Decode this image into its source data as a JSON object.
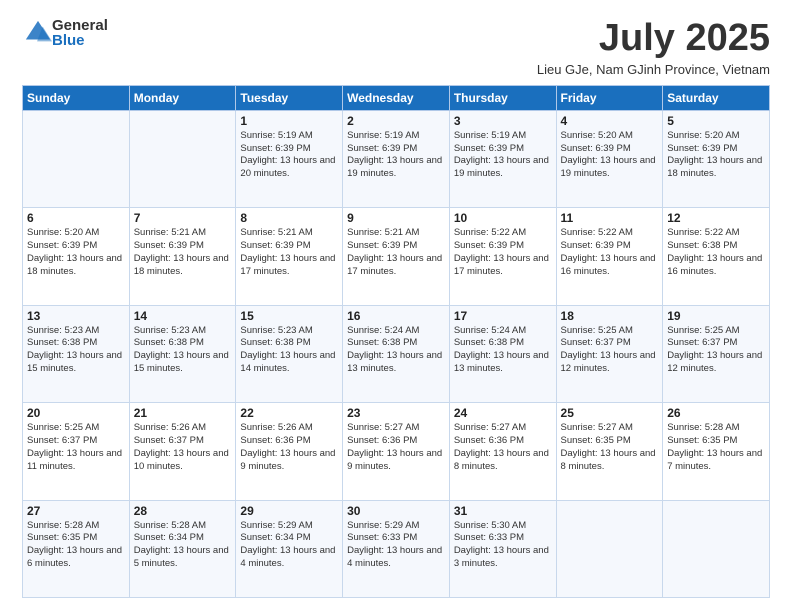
{
  "logo": {
    "general": "General",
    "blue": "Blue"
  },
  "header": {
    "month": "July 2025",
    "location": "Lieu GJe, Nam GJinh Province, Vietnam"
  },
  "days_of_week": [
    "Sunday",
    "Monday",
    "Tuesday",
    "Wednesday",
    "Thursday",
    "Friday",
    "Saturday"
  ],
  "weeks": [
    [
      {
        "day": "",
        "info": ""
      },
      {
        "day": "",
        "info": ""
      },
      {
        "day": "1",
        "info": "Sunrise: 5:19 AM\nSunset: 6:39 PM\nDaylight: 13 hours and 20 minutes."
      },
      {
        "day": "2",
        "info": "Sunrise: 5:19 AM\nSunset: 6:39 PM\nDaylight: 13 hours and 19 minutes."
      },
      {
        "day": "3",
        "info": "Sunrise: 5:19 AM\nSunset: 6:39 PM\nDaylight: 13 hours and 19 minutes."
      },
      {
        "day": "4",
        "info": "Sunrise: 5:20 AM\nSunset: 6:39 PM\nDaylight: 13 hours and 19 minutes."
      },
      {
        "day": "5",
        "info": "Sunrise: 5:20 AM\nSunset: 6:39 PM\nDaylight: 13 hours and 18 minutes."
      }
    ],
    [
      {
        "day": "6",
        "info": "Sunrise: 5:20 AM\nSunset: 6:39 PM\nDaylight: 13 hours and 18 minutes."
      },
      {
        "day": "7",
        "info": "Sunrise: 5:21 AM\nSunset: 6:39 PM\nDaylight: 13 hours and 18 minutes."
      },
      {
        "day": "8",
        "info": "Sunrise: 5:21 AM\nSunset: 6:39 PM\nDaylight: 13 hours and 17 minutes."
      },
      {
        "day": "9",
        "info": "Sunrise: 5:21 AM\nSunset: 6:39 PM\nDaylight: 13 hours and 17 minutes."
      },
      {
        "day": "10",
        "info": "Sunrise: 5:22 AM\nSunset: 6:39 PM\nDaylight: 13 hours and 17 minutes."
      },
      {
        "day": "11",
        "info": "Sunrise: 5:22 AM\nSunset: 6:39 PM\nDaylight: 13 hours and 16 minutes."
      },
      {
        "day": "12",
        "info": "Sunrise: 5:22 AM\nSunset: 6:38 PM\nDaylight: 13 hours and 16 minutes."
      }
    ],
    [
      {
        "day": "13",
        "info": "Sunrise: 5:23 AM\nSunset: 6:38 PM\nDaylight: 13 hours and 15 minutes."
      },
      {
        "day": "14",
        "info": "Sunrise: 5:23 AM\nSunset: 6:38 PM\nDaylight: 13 hours and 15 minutes."
      },
      {
        "day": "15",
        "info": "Sunrise: 5:23 AM\nSunset: 6:38 PM\nDaylight: 13 hours and 14 minutes."
      },
      {
        "day": "16",
        "info": "Sunrise: 5:24 AM\nSunset: 6:38 PM\nDaylight: 13 hours and 13 minutes."
      },
      {
        "day": "17",
        "info": "Sunrise: 5:24 AM\nSunset: 6:38 PM\nDaylight: 13 hours and 13 minutes."
      },
      {
        "day": "18",
        "info": "Sunrise: 5:25 AM\nSunset: 6:37 PM\nDaylight: 13 hours and 12 minutes."
      },
      {
        "day": "19",
        "info": "Sunrise: 5:25 AM\nSunset: 6:37 PM\nDaylight: 13 hours and 12 minutes."
      }
    ],
    [
      {
        "day": "20",
        "info": "Sunrise: 5:25 AM\nSunset: 6:37 PM\nDaylight: 13 hours and 11 minutes."
      },
      {
        "day": "21",
        "info": "Sunrise: 5:26 AM\nSunset: 6:37 PM\nDaylight: 13 hours and 10 minutes."
      },
      {
        "day": "22",
        "info": "Sunrise: 5:26 AM\nSunset: 6:36 PM\nDaylight: 13 hours and 9 minutes."
      },
      {
        "day": "23",
        "info": "Sunrise: 5:27 AM\nSunset: 6:36 PM\nDaylight: 13 hours and 9 minutes."
      },
      {
        "day": "24",
        "info": "Sunrise: 5:27 AM\nSunset: 6:36 PM\nDaylight: 13 hours and 8 minutes."
      },
      {
        "day": "25",
        "info": "Sunrise: 5:27 AM\nSunset: 6:35 PM\nDaylight: 13 hours and 8 minutes."
      },
      {
        "day": "26",
        "info": "Sunrise: 5:28 AM\nSunset: 6:35 PM\nDaylight: 13 hours and 7 minutes."
      }
    ],
    [
      {
        "day": "27",
        "info": "Sunrise: 5:28 AM\nSunset: 6:35 PM\nDaylight: 13 hours and 6 minutes."
      },
      {
        "day": "28",
        "info": "Sunrise: 5:28 AM\nSunset: 6:34 PM\nDaylight: 13 hours and 5 minutes."
      },
      {
        "day": "29",
        "info": "Sunrise: 5:29 AM\nSunset: 6:34 PM\nDaylight: 13 hours and 4 minutes."
      },
      {
        "day": "30",
        "info": "Sunrise: 5:29 AM\nSunset: 6:33 PM\nDaylight: 13 hours and 4 minutes."
      },
      {
        "day": "31",
        "info": "Sunrise: 5:30 AM\nSunset: 6:33 PM\nDaylight: 13 hours and 3 minutes."
      },
      {
        "day": "",
        "info": ""
      },
      {
        "day": "",
        "info": ""
      }
    ]
  ]
}
